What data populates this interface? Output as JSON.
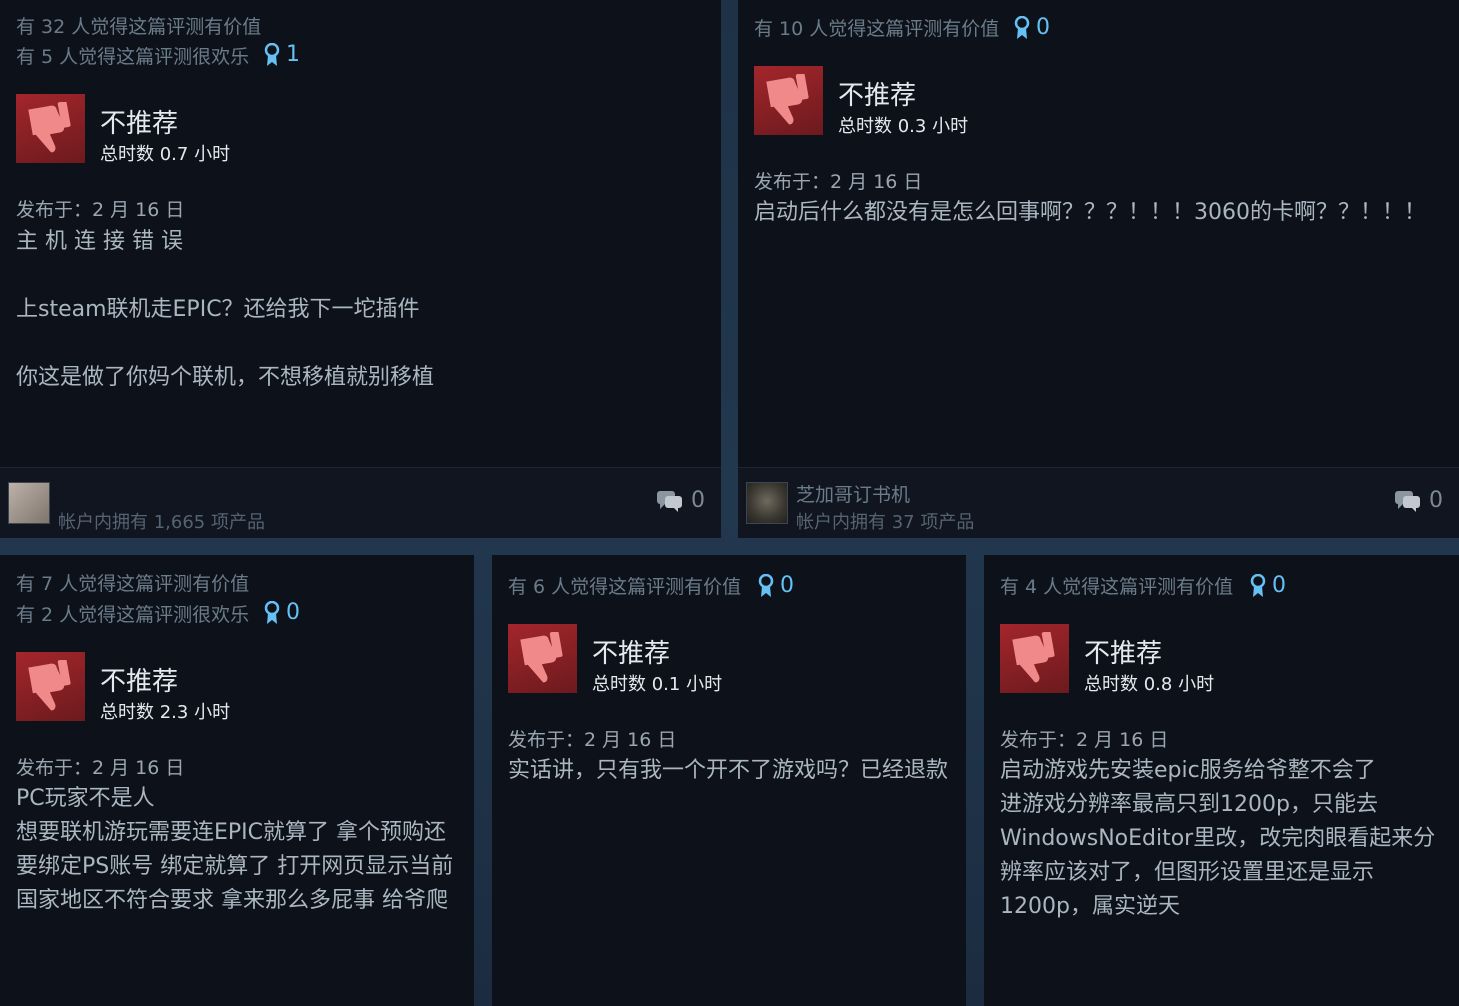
{
  "reviews": [
    {
      "helpful": "有 32 人觉得这篇评测有价值",
      "funny": "有 5 人觉得这篇评测很欢乐",
      "awards": "1",
      "verdict": "不推荐",
      "hours": "总时数 0.7 小时",
      "posted": "发布于：2 月 16 日",
      "body": "主 机 连 接 错 误\n\n上steam联机走EPIC？还给我下一坨插件\n\n你这是做了你妈个联机，不想移植就别移植",
      "author": "",
      "owned": "帐户内拥有 1,665 项产品",
      "comments": "0"
    },
    {
      "helpful": "有 10 人觉得这篇评测有价值",
      "awards": "0",
      "verdict": "不推荐",
      "hours": "总时数 0.3 小时",
      "posted": "发布于：2 月 16 日",
      "body": "启动后什么都没有是怎么回事啊？？？！！！3060的卡啊？？！！！",
      "author": "芝加哥订书机",
      "owned": "帐户内拥有 37 项产品",
      "comments": "0"
    },
    {
      "helpful": "有 7 人觉得这篇评测有价值",
      "funny": "有 2 人觉得这篇评测很欢乐",
      "awards": "0",
      "verdict": "不推荐",
      "hours": "总时数 2.3 小时",
      "posted": "发布于：2 月 16 日",
      "body": "PC玩家不是人\n想要联机游玩需要连EPIC就算了 拿个预购还\n要绑定PS账号 绑定就算了 打开网页显示当前\n国家地区不符合要求 拿来那么多屁事 给爷爬"
    },
    {
      "helpful": "有 6 人觉得这篇评测有价值",
      "awards": "0",
      "verdict": "不推荐",
      "hours": "总时数 0.1 小时",
      "posted": "发布于：2 月 16 日",
      "body": "实话讲，只有我一个开不了游戏吗？已经退款"
    },
    {
      "helpful": "有 4 人觉得这篇评测有价值",
      "awards": "0",
      "verdict": "不推荐",
      "hours": "总时数 0.8 小时",
      "posted": "发布于：2 月 16 日",
      "body": "启动游戏先安装epic服务给爷整不会了\n进游戏分辨率最高只到1200p，只能去\nWindowsNoEditor里改，改完肉眼看起来分\n辨率应该对了，但图形设置里还是显示\n1200p，属实逆天"
    }
  ]
}
